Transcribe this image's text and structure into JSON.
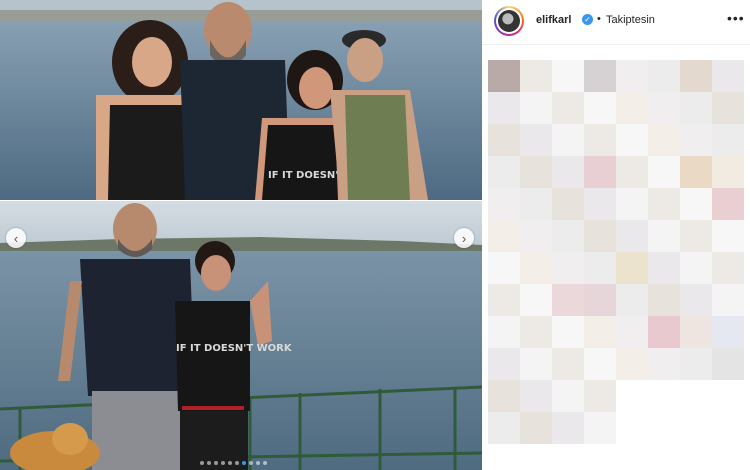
{
  "post": {
    "username": "elifkarl",
    "verified_icon": "verified-badge-icon",
    "separator": "•",
    "follow_status": "Takiptesin",
    "more_icon": "more-options-icon",
    "more_glyph": "•••"
  },
  "carousel": {
    "prev_glyph": "‹",
    "next_glyph": "›",
    "current_index": 6,
    "total": 10
  },
  "photo_top_shirt_text": "IF IT DOESN'T WORK",
  "photo_bottom_shirt_text": "IF IT DOESN'T WORK",
  "colors": {
    "accent": "#3897f0",
    "text": "#262626",
    "sea": "#5f7f95",
    "sky": "#c8d4de"
  }
}
